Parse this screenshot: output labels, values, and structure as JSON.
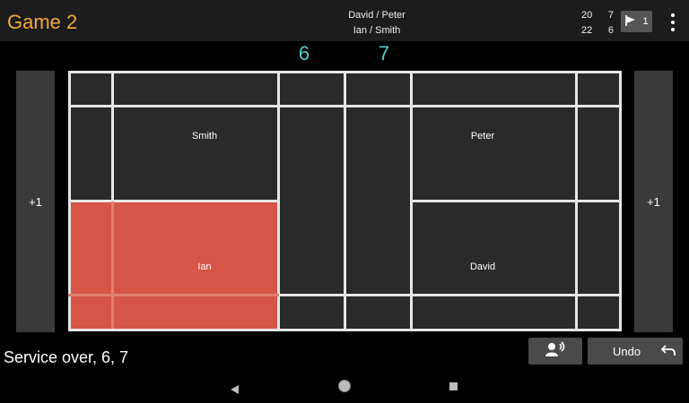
{
  "header": {
    "title": "Game 2",
    "team_top": "David / Peter",
    "team_bottom": "Ian / Smith",
    "scores": [
      {
        "game1": "20",
        "game2": "7"
      },
      {
        "game1": "22",
        "game2": "6"
      }
    ],
    "flag_count": "1",
    "flag_icon": "shuttlecock-flag-icon",
    "menu_icon": "more-vert-icon"
  },
  "current_score": {
    "left": "6",
    "right": "7"
  },
  "court": {
    "players": {
      "top_left": "Smith",
      "bottom_left": "Ian",
      "top_right": "Peter",
      "bottom_right": "David"
    },
    "highlight_color": "#d65546"
  },
  "side_buttons": {
    "left": "+1",
    "right": "+1"
  },
  "status_text": "Service over, 6, 7",
  "actions": {
    "announce_icon": "speak-icon",
    "undo_label": "Undo",
    "undo_icon": "undo-icon"
  },
  "accent_colors": {
    "title": "#f2a93b",
    "score": "#4ed0c9"
  }
}
